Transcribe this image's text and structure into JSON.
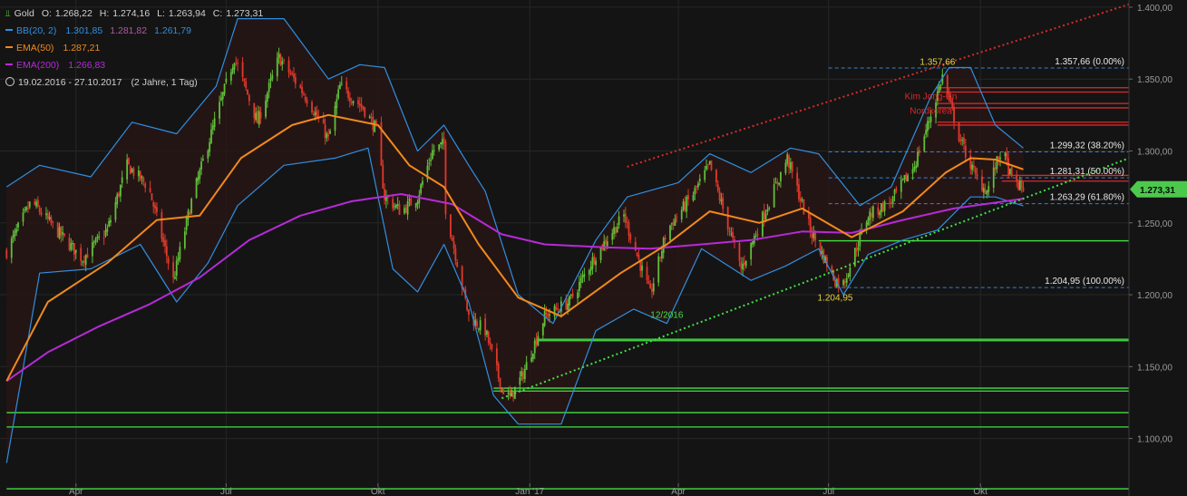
{
  "legend": {
    "instrument": "Gold",
    "ohlc": {
      "o_label": "O:",
      "o": "1.268,22",
      "h_label": "H:",
      "h": "1.274,16",
      "l_label": "L:",
      "l": "1.263,94",
      "c_label": "C:",
      "c": "1.273,31"
    },
    "bb": {
      "label": "BB(20, 2)",
      "v1": "1.301,85",
      "v2": "1.281,82",
      "v3": "1.261,79"
    },
    "ema50": {
      "label": "EMA(50)",
      "v": "1.287,21"
    },
    "ema200": {
      "label": "EMA(200)",
      "v": "1.266,83"
    },
    "range": {
      "dates": "19.02.2016 - 27.10.2017",
      "extra": "(2 Jahre, 1 Tag)"
    }
  },
  "colors": {
    "background": "#141414",
    "grid": "#262626",
    "up": "#5fbf3a",
    "down": "#e0392b",
    "bb": "#2f8fe0",
    "ema50": "#f08a1c",
    "ema200": "#b72ad8",
    "support": "#44e044",
    "resistance": "#d92a2a",
    "fib": "#3a7fd0",
    "annotation_yellow": "#e8d040",
    "last_price_bg": "#4cc94c",
    "axis_text": "#9a9a9a"
  },
  "chart_data": {
    "type": "candlestick",
    "title": "Gold",
    "x_range": [
      "2016-02-19",
      "2017-10-27"
    ],
    "y_range": [
      1060,
      1405
    ],
    "x_ticks": [
      {
        "date": "2016-04-01",
        "label": "Apr"
      },
      {
        "date": "2016-07-01",
        "label": "Jul"
      },
      {
        "date": "2016-10-01",
        "label": "Okt"
      },
      {
        "date": "2017-01-01",
        "label": "Jan '17"
      },
      {
        "date": "2017-04-01",
        "label": "Apr"
      },
      {
        "date": "2017-07-01",
        "label": "Jul"
      },
      {
        "date": "2017-10-01",
        "label": "Okt"
      }
    ],
    "y_ticks": [
      {
        "value": 1100,
        "label": "1.100,00"
      },
      {
        "value": 1150,
        "label": "1.150,00"
      },
      {
        "value": 1200,
        "label": "1.200,00"
      },
      {
        "value": 1250,
        "label": "1.250,00"
      },
      {
        "value": 1300,
        "label": "1.300,00"
      },
      {
        "value": 1350,
        "label": "1.350,00"
      },
      {
        "value": 1400,
        "label": "1.400,00"
      }
    ],
    "last_price": {
      "value": 1273.31,
      "label": "1.273,31"
    },
    "close_path": [
      [
        "2016-02-19",
        1230
      ],
      [
        "2016-03-05",
        1265
      ],
      [
        "2016-03-20",
        1245
      ],
      [
        "2016-04-05",
        1225
      ],
      [
        "2016-04-20",
        1245
      ],
      [
        "2016-05-02",
        1290
      ],
      [
        "2016-05-15",
        1275
      ],
      [
        "2016-05-30",
        1210
      ],
      [
        "2016-06-10",
        1265
      ],
      [
        "2016-06-24",
        1320
      ],
      [
        "2016-07-06",
        1365
      ],
      [
        "2016-07-20",
        1320
      ],
      [
        "2016-08-02",
        1365
      ],
      [
        "2016-08-20",
        1335
      ],
      [
        "2016-09-01",
        1308
      ],
      [
        "2016-09-08",
        1345
      ],
      [
        "2016-09-22",
        1330
      ],
      [
        "2016-09-30",
        1315
      ],
      [
        "2016-10-05",
        1268
      ],
      [
        "2016-10-15",
        1258
      ],
      [
        "2016-10-25",
        1268
      ],
      [
        "2016-11-03",
        1300
      ],
      [
        "2016-11-10",
        1305
      ],
      [
        "2016-11-11",
        1260
      ],
      [
        "2016-11-25",
        1185
      ],
      [
        "2016-12-05",
        1175
      ],
      [
        "2016-12-15",
        1135
      ],
      [
        "2016-12-20",
        1128
      ],
      [
        "2016-12-28",
        1145
      ],
      [
        "2017-01-10",
        1185
      ],
      [
        "2017-01-25",
        1195
      ],
      [
        "2017-02-10",
        1228
      ],
      [
        "2017-02-27",
        1255
      ],
      [
        "2017-03-15",
        1200
      ],
      [
        "2017-03-25",
        1245
      ],
      [
        "2017-04-10",
        1270
      ],
      [
        "2017-04-20",
        1290
      ],
      [
        "2017-05-09",
        1218
      ],
      [
        "2017-05-25",
        1262
      ],
      [
        "2017-06-06",
        1295
      ],
      [
        "2017-06-20",
        1245
      ],
      [
        "2017-07-05",
        1210
      ],
      [
        "2017-07-10",
        1208
      ],
      [
        "2017-07-25",
        1255
      ],
      [
        "2017-08-08",
        1265
      ],
      [
        "2017-08-22",
        1290
      ],
      [
        "2017-09-01",
        1325
      ],
      [
        "2017-09-08",
        1352
      ],
      [
        "2017-09-18",
        1310
      ],
      [
        "2017-09-28",
        1282
      ],
      [
        "2017-10-05",
        1272
      ],
      [
        "2017-10-14",
        1302
      ],
      [
        "2017-10-20",
        1280
      ],
      [
        "2017-10-27",
        1273.31
      ]
    ],
    "bollinger_upper": [
      [
        "2016-02-19",
        1275
      ],
      [
        "2016-03-10",
        1290
      ],
      [
        "2016-04-10",
        1282
      ],
      [
        "2016-05-05",
        1320
      ],
      [
        "2016-06-01",
        1312
      ],
      [
        "2016-06-25",
        1345
      ],
      [
        "2016-07-08",
        1392
      ],
      [
        "2016-08-05",
        1392
      ],
      [
        "2016-09-01",
        1350
      ],
      [
        "2016-09-20",
        1360
      ],
      [
        "2016-10-05",
        1358
      ],
      [
        "2016-10-25",
        1300
      ],
      [
        "2016-11-10",
        1318
      ],
      [
        "2016-11-25",
        1290
      ],
      [
        "2016-12-05",
        1272
      ],
      [
        "2016-12-25",
        1200
      ],
      [
        "2017-01-15",
        1180
      ],
      [
        "2017-02-10",
        1238
      ],
      [
        "2017-03-01",
        1268
      ],
      [
        "2017-04-01",
        1278
      ],
      [
        "2017-04-20",
        1298
      ],
      [
        "2017-05-15",
        1285
      ],
      [
        "2017-06-08",
        1302
      ],
      [
        "2017-06-25",
        1298
      ],
      [
        "2017-07-20",
        1262
      ],
      [
        "2017-08-08",
        1275
      ],
      [
        "2017-09-01",
        1338
      ],
      [
        "2017-09-12",
        1358
      ],
      [
        "2017-09-25",
        1358
      ],
      [
        "2017-10-10",
        1318
      ],
      [
        "2017-10-27",
        1302
      ]
    ],
    "bollinger_lower": [
      [
        "2016-02-19",
        1083
      ],
      [
        "2016-03-10",
        1215
      ],
      [
        "2016-04-10",
        1218
      ],
      [
        "2016-05-10",
        1235
      ],
      [
        "2016-06-01",
        1195
      ],
      [
        "2016-06-20",
        1222
      ],
      [
        "2016-07-08",
        1262
      ],
      [
        "2016-08-05",
        1290
      ],
      [
        "2016-09-05",
        1295
      ],
      [
        "2016-09-25",
        1302
      ],
      [
        "2016-10-10",
        1218
      ],
      [
        "2016-10-25",
        1202
      ],
      [
        "2016-11-10",
        1235
      ],
      [
        "2016-11-25",
        1195
      ],
      [
        "2016-12-10",
        1130
      ],
      [
        "2016-12-25",
        1110
      ],
      [
        "2017-01-20",
        1110
      ],
      [
        "2017-02-10",
        1175
      ],
      [
        "2017-03-05",
        1190
      ],
      [
        "2017-03-25",
        1180
      ],
      [
        "2017-04-15",
        1232
      ],
      [
        "2017-05-15",
        1210
      ],
      [
        "2017-06-05",
        1220
      ],
      [
        "2017-06-25",
        1232
      ],
      [
        "2017-07-10",
        1200
      ],
      [
        "2017-07-25",
        1228
      ],
      [
        "2017-08-15",
        1238
      ],
      [
        "2017-09-05",
        1245
      ],
      [
        "2017-09-25",
        1268
      ],
      [
        "2017-10-10",
        1268
      ],
      [
        "2017-10-27",
        1261.79
      ]
    ],
    "ema50": [
      [
        "2016-02-19",
        1140
      ],
      [
        "2016-03-15",
        1195
      ],
      [
        "2016-04-20",
        1222
      ],
      [
        "2016-05-20",
        1252
      ],
      [
        "2016-06-15",
        1255
      ],
      [
        "2016-07-10",
        1295
      ],
      [
        "2016-08-10",
        1318
      ],
      [
        "2016-09-01",
        1325
      ],
      [
        "2016-10-01",
        1318
      ],
      [
        "2016-10-20",
        1290
      ],
      [
        "2016-11-10",
        1275
      ],
      [
        "2016-12-01",
        1235
      ],
      [
        "2016-12-25",
        1198
      ],
      [
        "2017-01-20",
        1185
      ],
      [
        "2017-02-25",
        1215
      ],
      [
        "2017-03-25",
        1235
      ],
      [
        "2017-04-20",
        1258
      ],
      [
        "2017-05-20",
        1250
      ],
      [
        "2017-06-15",
        1260
      ],
      [
        "2017-07-15",
        1240
      ],
      [
        "2017-08-15",
        1258
      ],
      [
        "2017-09-10",
        1285
      ],
      [
        "2017-09-25",
        1295
      ],
      [
        "2017-10-10",
        1294
      ],
      [
        "2017-10-27",
        1287.21
      ]
    ],
    "ema200": [
      [
        "2016-02-19",
        1140
      ],
      [
        "2016-03-15",
        1160
      ],
      [
        "2016-04-15",
        1178
      ],
      [
        "2016-05-15",
        1193
      ],
      [
        "2016-06-15",
        1212
      ],
      [
        "2016-07-15",
        1238
      ],
      [
        "2016-08-15",
        1255
      ],
      [
        "2016-09-15",
        1265
      ],
      [
        "2016-10-15",
        1270
      ],
      [
        "2016-11-15",
        1263
      ],
      [
        "2016-12-15",
        1242
      ],
      [
        "2017-01-10",
        1235
      ],
      [
        "2017-02-15",
        1233
      ],
      [
        "2017-03-15",
        1232
      ],
      [
        "2017-04-15",
        1235
      ],
      [
        "2017-05-15",
        1238
      ],
      [
        "2017-06-15",
        1244
      ],
      [
        "2017-07-15",
        1243
      ],
      [
        "2017-08-15",
        1252
      ],
      [
        "2017-09-15",
        1260
      ],
      [
        "2017-10-27",
        1266.83
      ]
    ],
    "trendlines": [
      {
        "color": "resistance",
        "from": [
          "2017-03-01",
          1289
        ],
        "to": [
          "2017-12-30",
          1402
        ]
      },
      {
        "color": "support",
        "from": [
          "2016-12-15",
          1128
        ],
        "to": [
          "2017-12-30",
          1295
        ]
      }
    ],
    "support_levels": [
      {
        "value": 1237.5,
        "from": "2017-06-25"
      },
      {
        "value": 1169,
        "from": "2017-01-05"
      },
      {
        "value": 1168,
        "from": "2017-01-05"
      },
      {
        "value": 1135,
        "from": "2016-12-10"
      },
      {
        "value": 1133,
        "from": "2016-12-10"
      },
      {
        "value": 1118,
        "from": "2016-02-19"
      },
      {
        "value": 1108,
        "from": "2016-02-19"
      },
      {
        "value": 1065,
        "from": "2016-02-19"
      }
    ],
    "resistance_levels": [
      {
        "value": 1344,
        "from": "2017-09-05"
      },
      {
        "value": 1341,
        "from": "2017-09-05"
      },
      {
        "value": 1333,
        "from": "2017-09-05"
      },
      {
        "value": 1330,
        "from": "2017-09-05"
      },
      {
        "value": 1320,
        "from": "2017-09-05"
      },
      {
        "value": 1318,
        "from": "2017-09-05"
      },
      {
        "value": 1283,
        "from": "2017-10-14"
      },
      {
        "value": 1279,
        "from": "2017-10-14"
      }
    ],
    "fibonacci": {
      "from_date": "2017-07-01",
      "levels": [
        {
          "value": 1357.66,
          "label": "1.357,66 (0.00%)"
        },
        {
          "value": 1299.32,
          "label": "1.299,32 (38.20%)"
        },
        {
          "value": 1281.31,
          "label": "1.281,31 (50.00%)"
        },
        {
          "value": 1263.29,
          "label": "1.263,29 (61.80%)"
        },
        {
          "value": 1204.95,
          "label": "1.204,95 (100.00%)"
        }
      ]
    },
    "annotations": [
      {
        "text": "1.357,66",
        "date": "2017-09-05",
        "value": 1360,
        "color": "annotation_yellow"
      },
      {
        "text": "1.204,95",
        "date": "2017-07-05",
        "value": 1196,
        "color": "annotation_yellow"
      },
      {
        "text": "Kim Jong-Un",
        "date": "2017-09-01",
        "value": 1336,
        "color": "resistance"
      },
      {
        "text": "Nordkorea",
        "date": "2017-09-01",
        "value": 1326,
        "color": "resistance"
      },
      {
        "text": "12/2016",
        "date": "2017-03-25",
        "value": 1184,
        "color": "support"
      }
    ]
  }
}
